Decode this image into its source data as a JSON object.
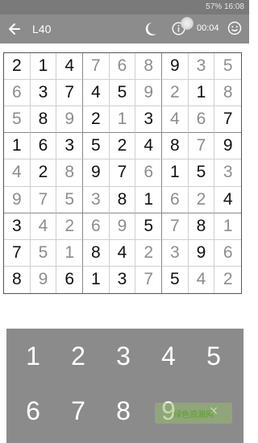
{
  "status_bar": {
    "battery": "57%",
    "time": "16:08"
  },
  "app_bar": {
    "level": "L40",
    "timer": "00:04"
  },
  "icons": {
    "back": "back-arrow-icon",
    "night_mode": "moon-icon",
    "info": "info-icon",
    "feedback": "smiley-icon"
  },
  "board": {
    "rows": [
      [
        "2",
        "1",
        "4",
        "7",
        "6",
        "8",
        "9",
        "3",
        "5"
      ],
      [
        "6",
        "3",
        "7",
        "4",
        "5",
        "9",
        "2",
        "1",
        "8"
      ],
      [
        "5",
        "8",
        "9",
        "2",
        "1",
        "3",
        "4",
        "6",
        "7"
      ],
      [
        "1",
        "6",
        "3",
        "5",
        "2",
        "4",
        "8",
        "7",
        "9"
      ],
      [
        "4",
        "2",
        "8",
        "9",
        "7",
        "6",
        "1",
        "5",
        "3"
      ],
      [
        "9",
        "7",
        "5",
        "3",
        "8",
        "1",
        "6",
        "2",
        "4"
      ],
      [
        "3",
        "4",
        "2",
        "6",
        "9",
        "5",
        "7",
        "8",
        "1"
      ],
      [
        "7",
        "5",
        "1",
        "8",
        "4",
        "2",
        "3",
        "9",
        "6"
      ],
      [
        "8",
        "9",
        "6",
        "1",
        "3",
        "7",
        "5",
        "4",
        "2"
      ]
    ],
    "user_entered": [
      [
        0,
        0,
        0,
        1,
        1,
        1,
        0,
        1,
        1
      ],
      [
        1,
        0,
        0,
        0,
        0,
        1,
        1,
        0,
        1
      ],
      [
        1,
        0,
        1,
        0,
        1,
        0,
        1,
        1,
        0
      ],
      [
        0,
        0,
        0,
        0,
        0,
        0,
        0,
        1,
        0
      ],
      [
        1,
        0,
        1,
        0,
        0,
        1,
        0,
        0,
        1
      ],
      [
        1,
        1,
        1,
        1,
        0,
        0,
        1,
        1,
        0
      ],
      [
        0,
        1,
        1,
        1,
        1,
        0,
        1,
        0,
        1
      ],
      [
        0,
        1,
        1,
        0,
        0,
        1,
        1,
        0,
        1
      ],
      [
        0,
        1,
        0,
        0,
        0,
        1,
        0,
        1,
        1
      ]
    ]
  },
  "keypad": {
    "keys": [
      "1",
      "2",
      "3",
      "4",
      "5",
      "6",
      "7",
      "8",
      "9",
      "×"
    ]
  },
  "watermark": "绿色资源网",
  "colors": {
    "app_bar": "#8c8c8c",
    "status_bar": "#7a7a7a",
    "keypad": "#8b8b8b",
    "given_digit": "#111111",
    "user_digit": "#8d8d8d"
  }
}
